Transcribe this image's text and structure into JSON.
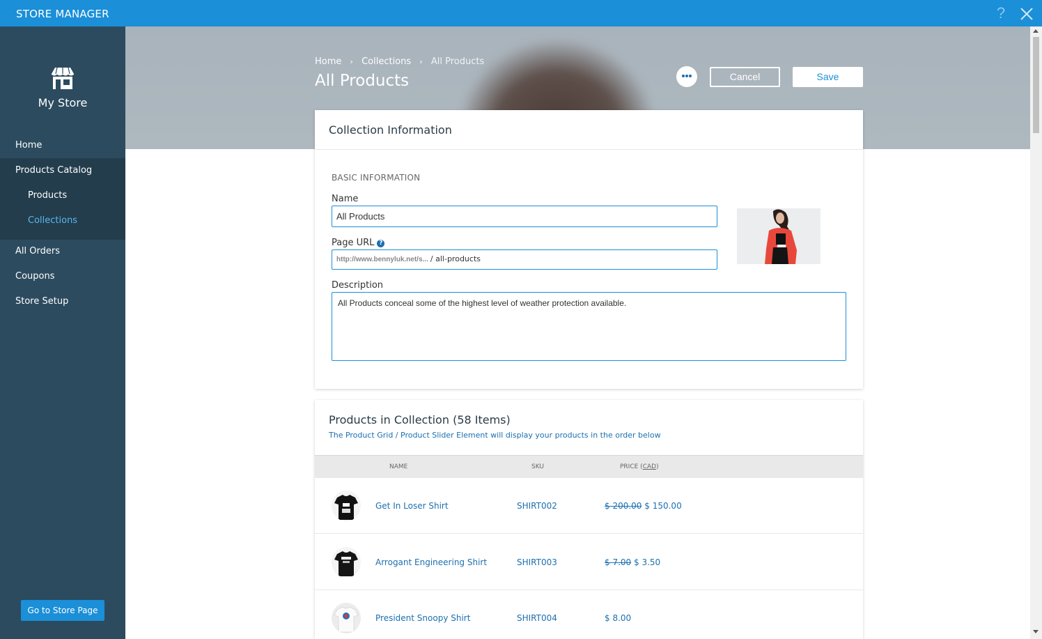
{
  "app": {
    "title": "STORE MANAGER",
    "help_glyph": "?"
  },
  "sidebar": {
    "store_name": "My Store",
    "items": [
      {
        "label": "Home"
      },
      {
        "label": "Products Catalog"
      },
      {
        "label": "Products"
      },
      {
        "label": "Collections"
      },
      {
        "label": "All Orders"
      },
      {
        "label": "Coupons"
      },
      {
        "label": "Store Setup"
      }
    ],
    "store_page_button": "Go to Store Page"
  },
  "header": {
    "breadcrumb": [
      "Home",
      "Collections",
      "All Products"
    ],
    "breadcrumb_separator": "›",
    "title": "All Products",
    "cancel_label": "Cancel",
    "save_label": "Save"
  },
  "collection_info": {
    "title": "Collection Information",
    "section_label": "BASIC INFORMATION",
    "name_label": "Name",
    "name_value": "All Products",
    "url_label": "Page URL",
    "url_help": "?",
    "url_prefix": "http://www.bennyluk.net/s...",
    "url_slug": "/ all-products",
    "description_label": "Description",
    "description_value": "All Products conceal some of the highest level of weather protection available."
  },
  "products": {
    "title": "Products in Collection (58 Items)",
    "subtitle": "The Product Grid / Product Slider Element will display your products in the order below",
    "columns": {
      "name": "NAME",
      "sku": "SKU",
      "price": "PRICE",
      "currency": "CAD"
    },
    "rows": [
      {
        "name": "Get In Loser Shirt",
        "sku": "SHIRT002",
        "old_price": "$ 200.00",
        "price": "$ 150.00",
        "shirt_color": "#111111"
      },
      {
        "name": "Arrogant Engineering Shirt",
        "sku": "SHIRT003",
        "old_price": "$ 7.00",
        "price": "$ 3.50",
        "shirt_color": "#151515"
      },
      {
        "name": "President Snoopy Shirt",
        "sku": "SHIRT004",
        "old_price": "",
        "price": "$ 8.00",
        "shirt_color": "#f4f4f4"
      }
    ]
  },
  "colors": {
    "accent": "#1b8fd8",
    "sidebar": "#2c4b5f",
    "link": "#1b6fb0"
  }
}
